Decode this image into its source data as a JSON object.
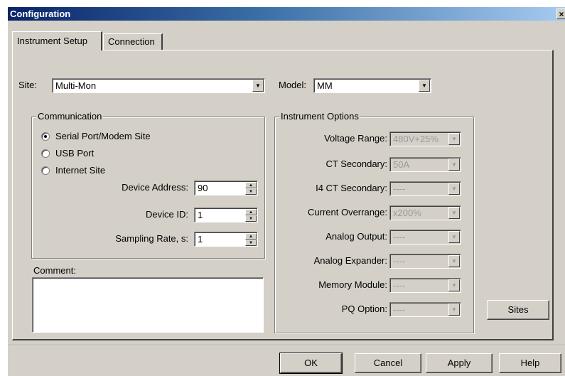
{
  "window": {
    "title": "Configuration",
    "close_label": "×"
  },
  "tabs": [
    {
      "label": "Instrument Setup"
    },
    {
      "label": "Connection"
    }
  ],
  "site": {
    "label": "Site:",
    "value": "Multi-Mon"
  },
  "model": {
    "label": "Model:",
    "value": "MM"
  },
  "communication": {
    "title": "Communication",
    "options": [
      {
        "label": "Serial Port/Modem Site",
        "selected": true
      },
      {
        "label": "USB Port",
        "selected": false
      },
      {
        "label": "Internet Site",
        "selected": false
      }
    ],
    "device_address": {
      "label": "Device Address:",
      "value": "90"
    },
    "device_id": {
      "label": "Device ID:",
      "value": "1"
    },
    "sampling_rate": {
      "label": "Sampling Rate, s:",
      "value": "1"
    }
  },
  "comment": {
    "label": "Comment:",
    "value": ""
  },
  "instrument_options": {
    "title": "Instrument Options",
    "fields": [
      {
        "label": "Voltage Range:",
        "value": "480V+25%"
      },
      {
        "label": "CT Secondary:",
        "value": "50A"
      },
      {
        "label": "I4 CT Secondary:",
        "value": "----"
      },
      {
        "label": "Current Overrange:",
        "value": "x200%"
      },
      {
        "label": "Analog Output:",
        "value": "----"
      },
      {
        "label": "Analog Expander:",
        "value": "----"
      },
      {
        "label": "Memory Module:",
        "value": "----"
      },
      {
        "label": "PQ Option:",
        "value": "----"
      }
    ]
  },
  "buttons": {
    "sites": "Sites",
    "ok": "OK",
    "cancel": "Cancel",
    "apply": "Apply",
    "help": "Help"
  },
  "icons": {
    "dropdown": "▼",
    "spin_up": "▲",
    "spin_down": "▼"
  }
}
